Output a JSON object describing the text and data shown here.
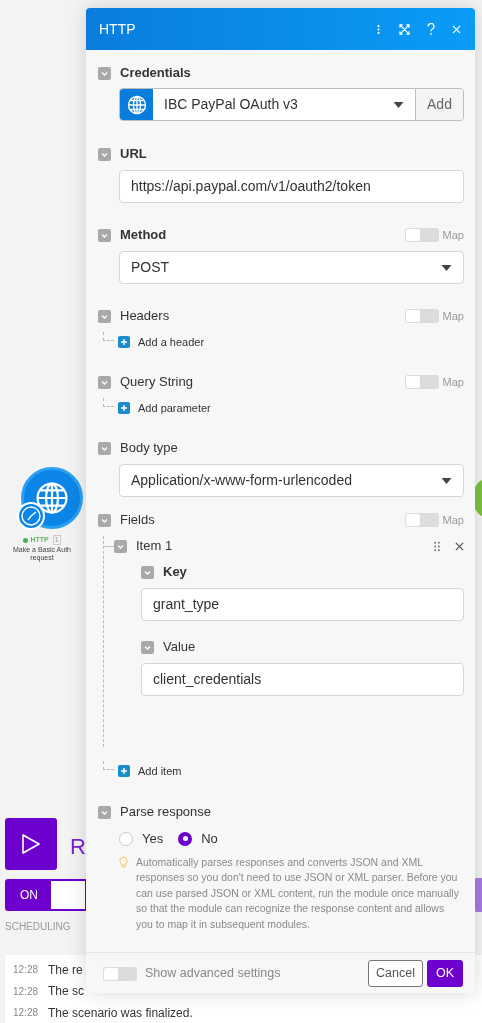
{
  "canvas": {
    "module": {
      "name": "HTTP",
      "badge": "1",
      "subtitle": "Make a Basic Auth request"
    },
    "run_label": "R",
    "schedule_toggle": {
      "label": "ON",
      "on": true
    },
    "scheduling": "SCHEDULING",
    "log": [
      {
        "time": "12:28",
        "text": "The re"
      },
      {
        "time": "12:28",
        "text": "The sc"
      },
      {
        "time": "12:28",
        "text": "The scenario was finalized."
      }
    ]
  },
  "dialog": {
    "title": "HTTP",
    "sections": [
      {
        "kind": "credentials",
        "label": "Credentials",
        "required": true,
        "value": "IBC PayPal OAuth v3",
        "button": "Add"
      },
      {
        "kind": "text",
        "label": "URL",
        "required": true,
        "value": "https://api.paypal.com/v1/oauth2/token"
      },
      {
        "kind": "select",
        "label": "Method",
        "required": true,
        "map_label": "Map",
        "map_on": false,
        "value": "POST"
      },
      {
        "kind": "list",
        "label": "Headers",
        "required": false,
        "map_label": "Map",
        "map_on": false,
        "add_label": "Add a header"
      },
      {
        "kind": "list",
        "label": "Query String",
        "required": false,
        "map_label": "Map",
        "map_on": false,
        "add_label": "Add parameter"
      },
      {
        "kind": "select",
        "label": "Body type",
        "required": false,
        "value": "Application/x-www-form-urlencoded"
      },
      {
        "kind": "fields",
        "label": "Fields",
        "required": false,
        "map_label": "Map",
        "map_on": false,
        "items": [
          {
            "title": "Item 1",
            "fields": [
              {
                "label": "Key",
                "required": true,
                "value": "grant_type"
              },
              {
                "label": "Value",
                "required": false,
                "value": "client_credentials"
              }
            ]
          }
        ],
        "add_label": "Add item"
      },
      {
        "kind": "radio",
        "label": "Parse response",
        "required": false,
        "options": [
          {
            "label": "Yes",
            "selected": false
          },
          {
            "label": "No",
            "selected": true
          }
        ],
        "hint": "Automatically parses responses and converts JSON and XML responses so you don't need to use JSON or XML parser. Before you can use parsed JSON or XML content, run the module once manually so that the module can recognize the response content and allows you to map it in subsequent modules."
      }
    ],
    "footer": {
      "advanced_label": "Show advanced settings",
      "advanced_on": false,
      "cancel": "Cancel",
      "ok": "OK"
    }
  }
}
